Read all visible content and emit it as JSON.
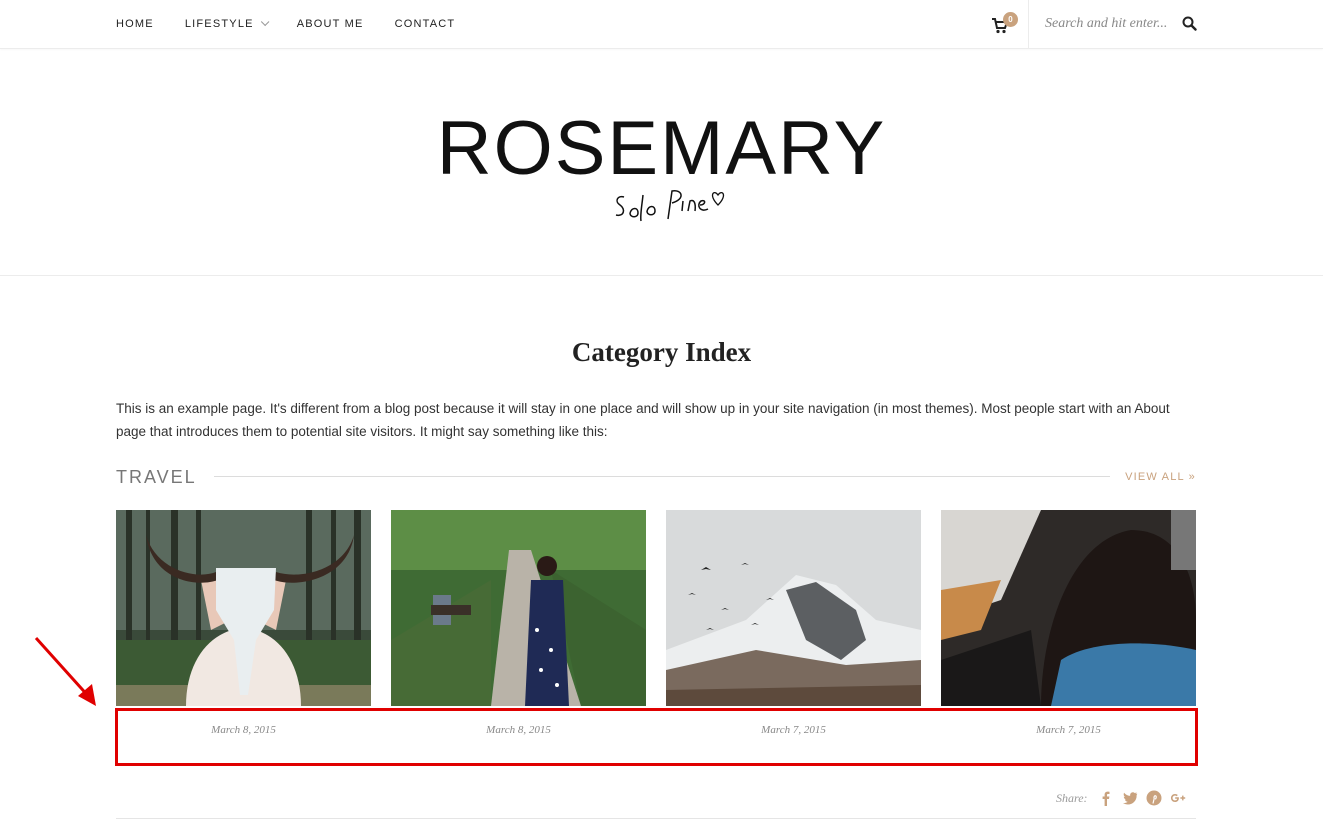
{
  "nav": {
    "items": [
      {
        "label": "HOME",
        "has_dropdown": false
      },
      {
        "label": "LIFESTYLE",
        "has_dropdown": true
      },
      {
        "label": "ABOUT ME",
        "has_dropdown": false
      },
      {
        "label": "CONTACT",
        "has_dropdown": false
      }
    ],
    "cart_count": "0",
    "search_placeholder": "Search and hit enter..."
  },
  "header": {
    "logo_title": "ROSEMARY",
    "logo_subtitle": "Solo Pine"
  },
  "content": {
    "page_title": "Category Index",
    "intro": "This is an example page. It's different from a blog post because it will stay in one place and will show up in your site navigation (in most themes). Most people start with an About page that introduces them to potential site visitors. It might say something like this:",
    "section": {
      "title": "TRAVEL",
      "view_all": "VIEW ALL »",
      "posts": [
        {
          "date": "March 8, 2015",
          "image": "woman-holding-skull-forest"
        },
        {
          "date": "March 8, 2015",
          "image": "woman-in-park-path"
        },
        {
          "date": "March 7, 2015",
          "image": "snowy-mountain-birds"
        },
        {
          "date": "March 7, 2015",
          "image": "woman-in-car-sunset"
        }
      ]
    },
    "share_label": "Share:",
    "share_icons": [
      "facebook-icon",
      "twitter-icon",
      "pinterest-icon",
      "google-plus-icon"
    ]
  },
  "colors": {
    "accent": "#c9a27e",
    "highlight": "#e00000"
  }
}
